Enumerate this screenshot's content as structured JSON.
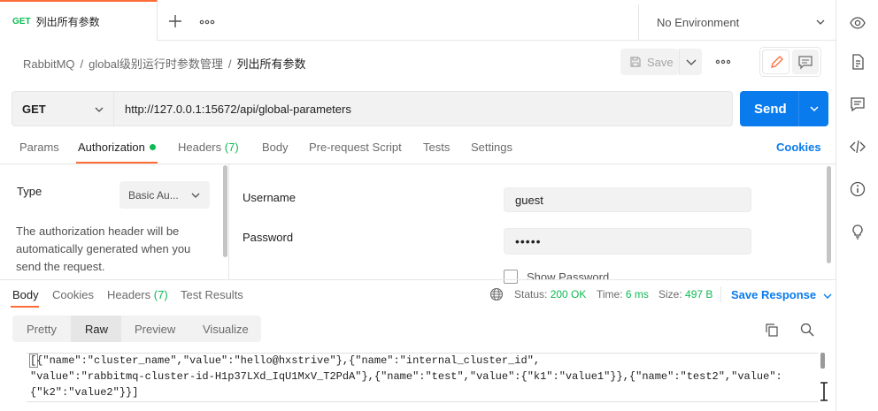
{
  "tab": {
    "method": "GET",
    "title": "列出所有参数"
  },
  "environment": {
    "selected": "No Environment"
  },
  "breadcrumb": {
    "collection": "RabbitMQ",
    "folder": "global级别运行时参数管理",
    "request": "列出所有参数",
    "separator": "/"
  },
  "toolbar": {
    "save_label": "Save"
  },
  "request": {
    "method": "GET",
    "url": "http://127.0.0.1:15672/api/global-parameters",
    "send_label": "Send"
  },
  "request_tabs": {
    "params": "Params",
    "authorization": "Authorization",
    "headers": "Headers",
    "headers_count": "(7)",
    "body": "Body",
    "prerequest": "Pre-request Script",
    "tests": "Tests",
    "settings": "Settings",
    "cookies": "Cookies"
  },
  "auth": {
    "type_label": "Type",
    "type_value": "Basic Au...",
    "description": "The authorization header will be automatically generated when you send the request.",
    "username_label": "Username",
    "username_value": "guest",
    "password_label": "Password",
    "password_value": "•••••",
    "show_password_label": "Show Password"
  },
  "response": {
    "tabs": {
      "body": "Body",
      "cookies": "Cookies",
      "headers": "Headers",
      "headers_count": "(7)",
      "test_results": "Test Results"
    },
    "status_label": "Status:",
    "status_value": "200 OK",
    "time_label": "Time:",
    "time_value": "6 ms",
    "size_label": "Size:",
    "size_value": "497 B",
    "save_response": "Save Response",
    "formats": {
      "pretty": "Pretty",
      "raw": "Raw",
      "preview": "Preview",
      "visualize": "Visualize"
    },
    "raw_lines": [
      "[{\"name\":\"cluster_name\",\"value\":\"hello@hxstrive\"},{\"name\":\"internal_cluster_id\",",
      "\"value\":\"rabbitmq-cluster-id-H1p37LXd_IqU1MxV_T2PdA\"},{\"name\":\"test\",\"value\":{\"k1\":\"value1\"}},{\"name\":\"test2\",\"value\":",
      "{\"k2\":\"value2\"}}]"
    ]
  },
  "colors": {
    "accent_orange": "#ff6c37",
    "send_blue": "#097bed",
    "status_green": "#0cbb52"
  }
}
